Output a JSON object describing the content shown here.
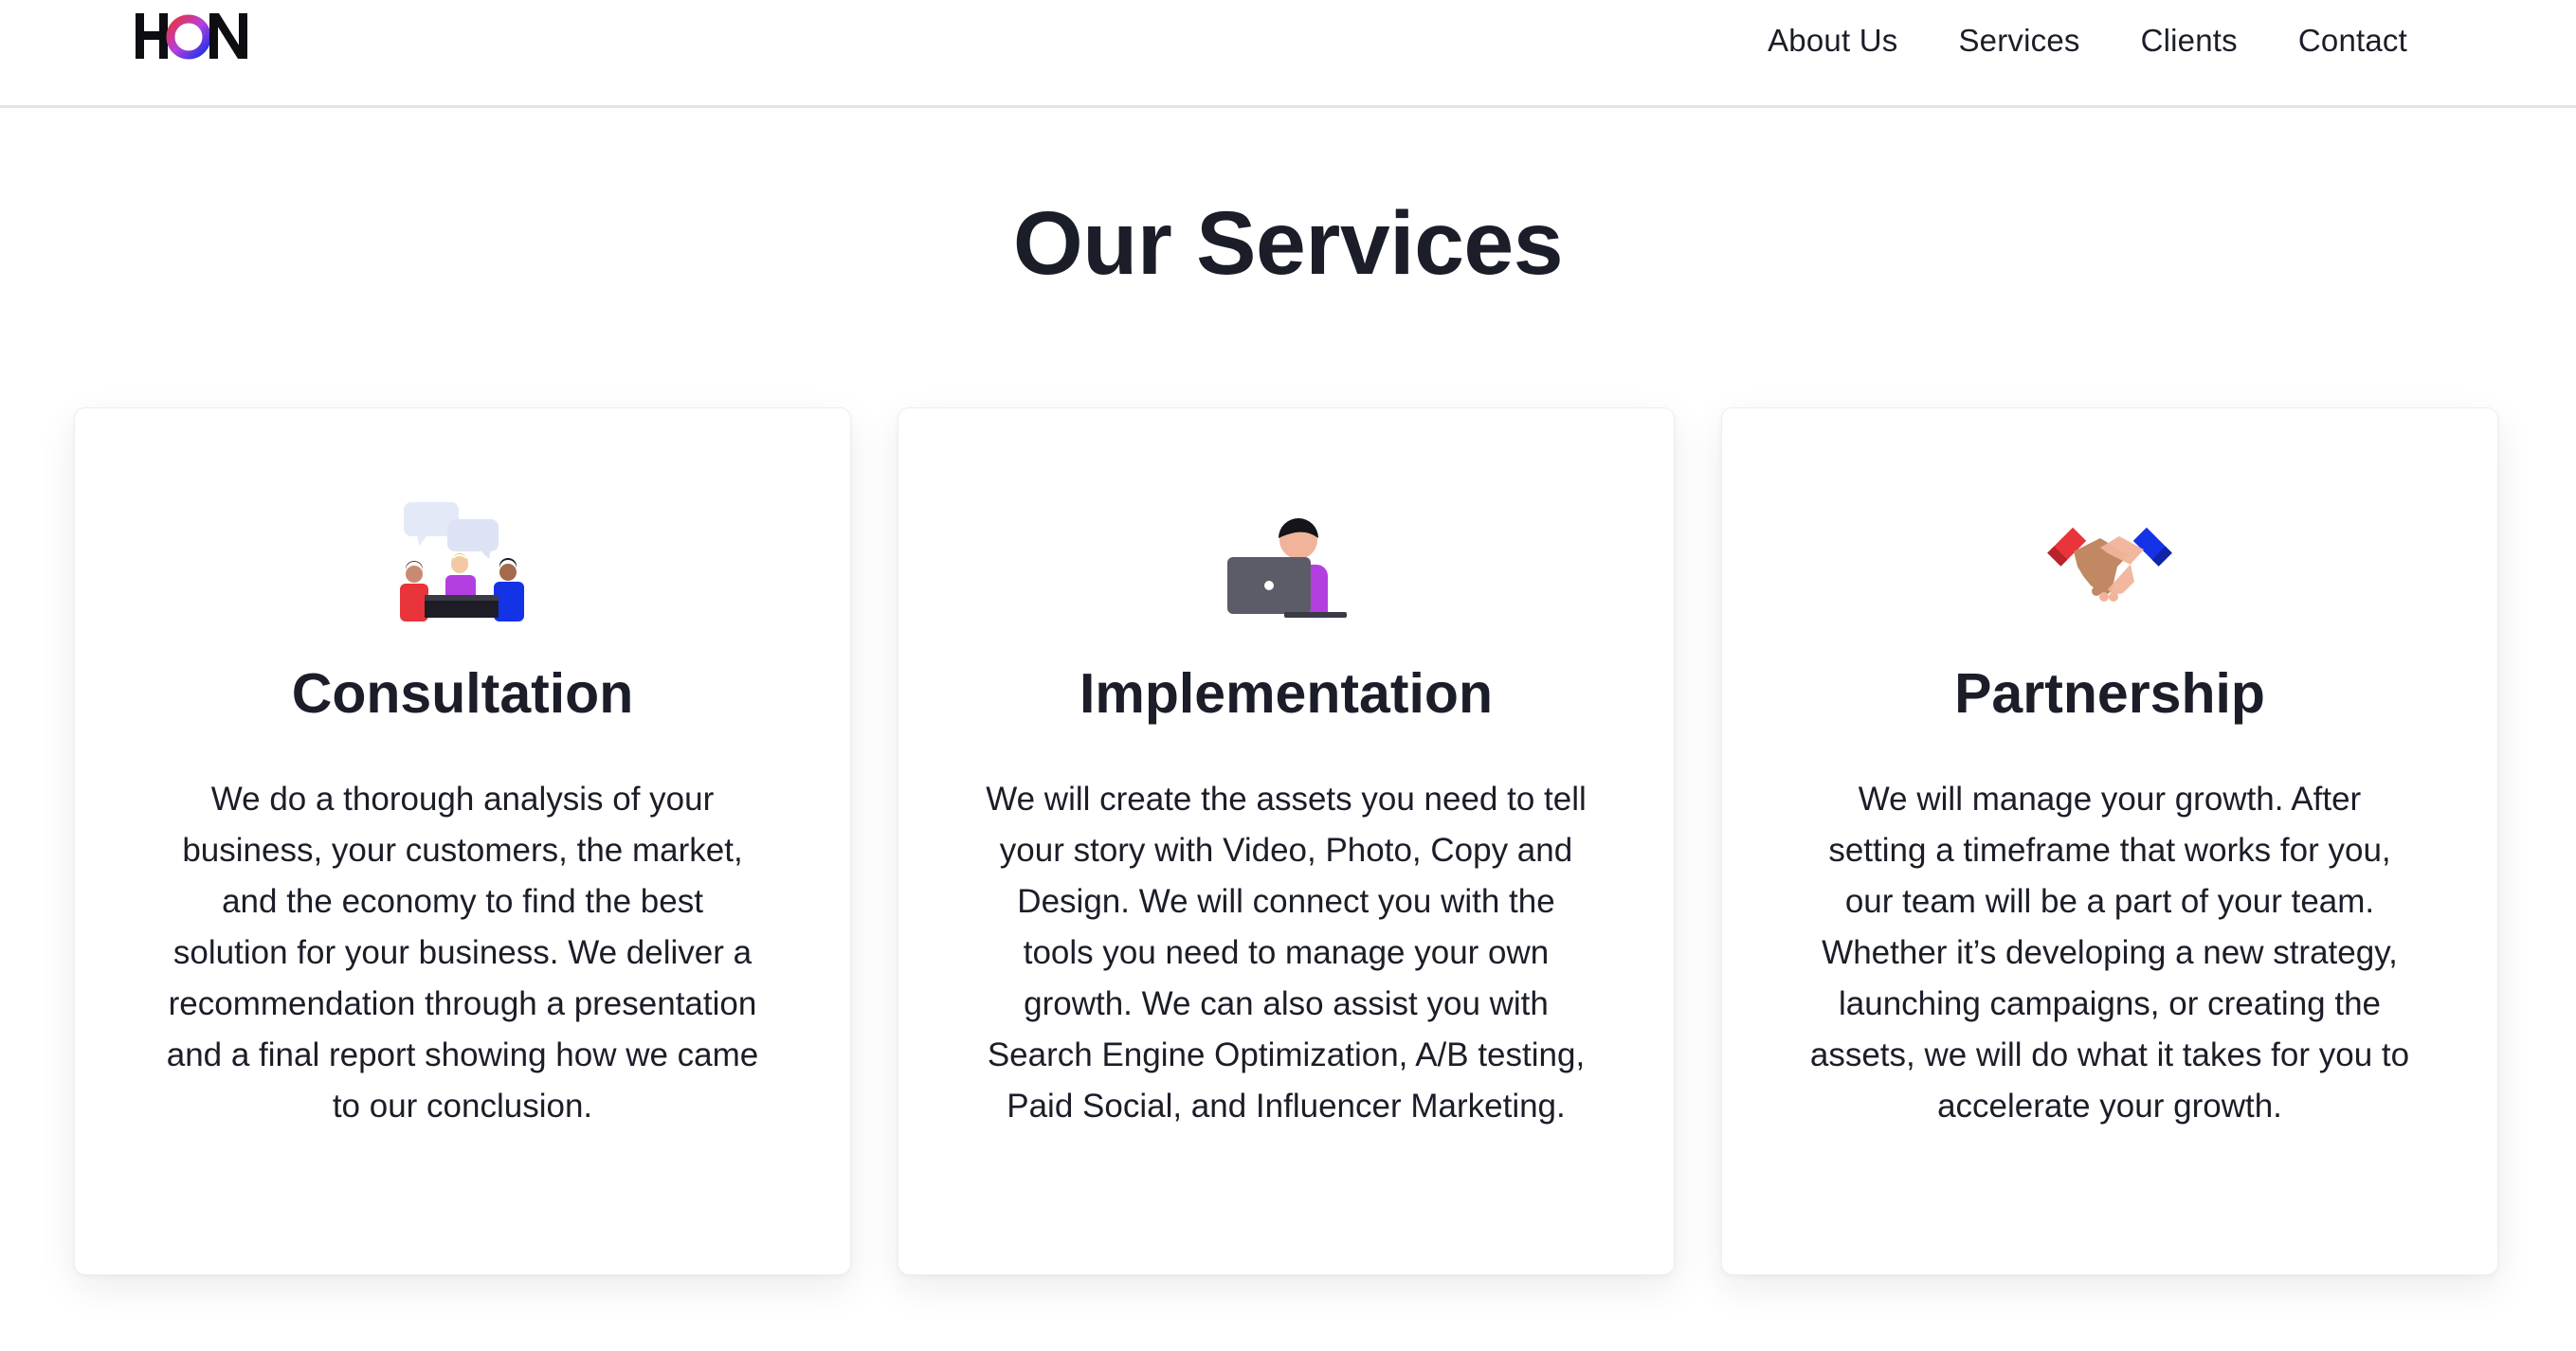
{
  "header": {
    "logo_text": "HON",
    "logo_icon": "hon-logo",
    "nav": [
      {
        "label": "About Us"
      },
      {
        "label": "Services"
      },
      {
        "label": "Clients"
      },
      {
        "label": "Contact"
      }
    ]
  },
  "services": {
    "title": "Our Services",
    "cards": [
      {
        "icon": "meeting-icon",
        "title": "Consultation",
        "text": "We do a thorough analysis of your business, your customers, the market, and the economy to find the best solution for your business. We deliver a recommendation through a presentation and a final report showing how we came to our conclusion."
      },
      {
        "icon": "laptop-user-icon",
        "title": "Implementation",
        "text": "We will create the assets you need to tell your story with Video, Photo, Copy and Design. We will connect you with the tools you need to manage your own growth. We can also assist you with Search Engine Optimization, A/B testing, Paid Social, and Influencer Marketing."
      },
      {
        "icon": "handshake-icon",
        "title": "Partnership",
        "text": "We will manage your growth. After setting a timeframe that works for you, our team will be a part of your team. Whether it’s developing a new strategy, launching campaigns, or creating the assets, we will do what it takes for you to accelerate your growth."
      }
    ]
  },
  "colors": {
    "text": "#1b1d28",
    "accent_red": "#e8343a",
    "accent_blue": "#1432e6",
    "accent_purple": "#b43fe0"
  }
}
